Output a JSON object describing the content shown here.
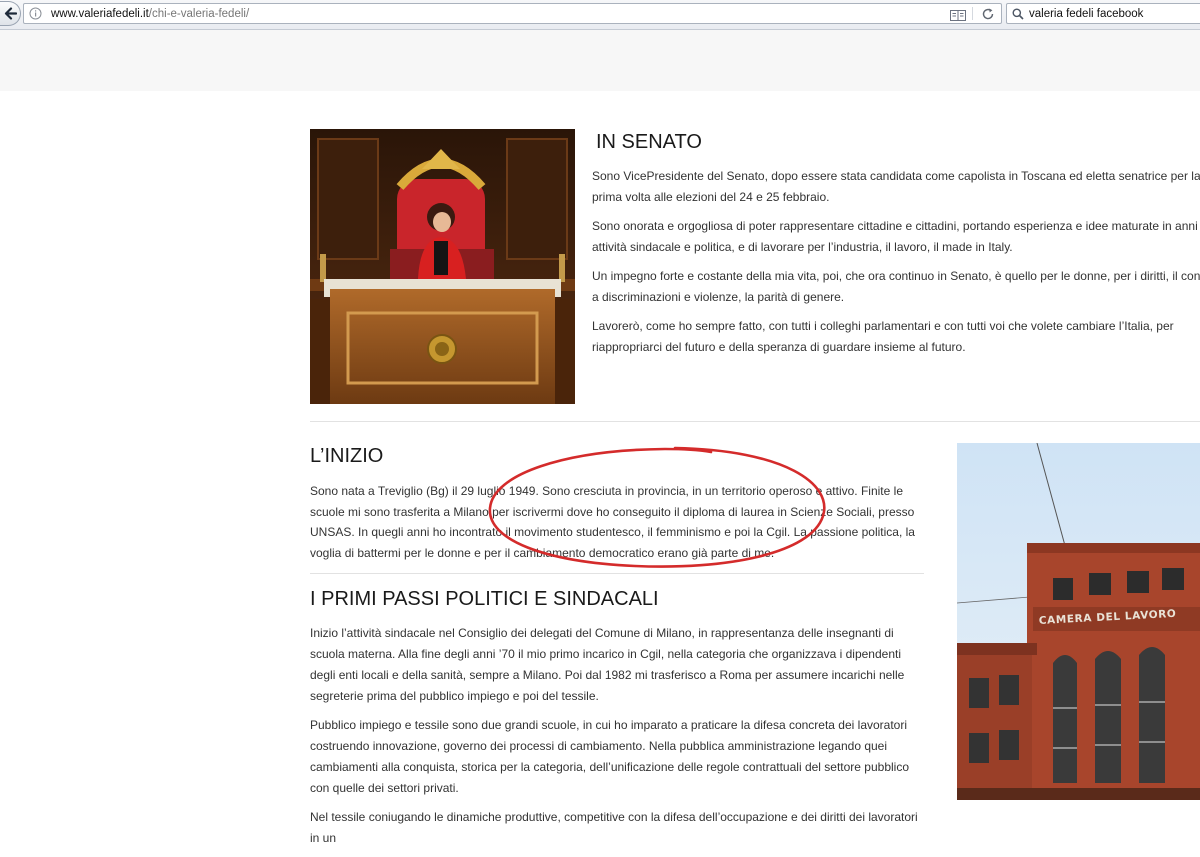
{
  "browser": {
    "url_domain": "www.valeriafedeli.it",
    "url_path": "/chi-e-valeria-fedeli/",
    "search_value": "valeria fedeli facebook"
  },
  "sections": {
    "senato": {
      "title": "IN SENATO",
      "paragraphs": [
        "Sono VicePresidente del Senato, dopo essere stata candidata come capolista in Toscana ed eletta senatrice per la prima volta alle elezioni del 24 e 25 febbraio.",
        "Sono onorata e orgogliosa di poter rappresentare cittadine e cittadini, portando esperienza e idee maturate in anni di attività sindacale e politica, e di lavorare per l’industria, il lavoro, il made in Italy.",
        "Un impegno forte e costante della mia vita, poi, che ora continuo in Senato, è quello per le donne, per i diritti, il contrasto a discriminazioni e violenze, la parità di genere.",
        "Lavorerò, come ho sempre fatto, con tutti i colleghi parlamentari e con tutti voi che volete cambiare l’Italia, per riappropriarci del futuro e della speranza di guardare insieme al futuro."
      ]
    },
    "inizio": {
      "title": "L’INIZIO",
      "paragraph": "Sono nata a Treviglio (Bg) il 29 luglio 1949. Sono cresciuta in provincia, in un territorio operoso e attivo. Finite le scuole mi sono trasferita a Milano per iscrivermi dove ho conseguito il diploma di laurea in Scienze Sociali, presso UNSAS. In quegli anni ho incontrato il movimento studentesco, il femminismo e poi la Cgil. La passione politica, la voglia di battermi per le donne e per il cambiamento democratico erano già parte di me."
    },
    "primi_passi": {
      "title": "I PRIMI PASSI POLITICI E SINDACALI",
      "paragraphs": [
        "Inizio l’attività sindacale nel Consiglio dei delegati del Comune di Milano, in rappresentanza delle insegnanti di scuola materna. Alla fine degli anni ’70 il mio primo incarico in Cgil, nella categoria che organizzava i dipendenti degli enti locali e della sanità, sempre a Milano. Poi dal 1982 mi trasferisco a Roma per assumere  incarichi nelle segreterie prima del pubblico impiego e poi del tessile.",
        "Pubblico impiego e tessile sono due grandi scuole, in cui ho imparato a praticare la difesa concreta dei lavoratori costruendo innovazione, governo dei processi di cambiamento. Nella pubblica amministrazione legando quei cambiamenti alla conquista, storica per la categoria, dell’unificazione delle regole contrattuali del settore pubblico con quelle dei settori privati.",
        "Nel tessile coniugando le dinamiche produttive, competitive con la difesa dell’occupazione e dei  diritti dei lavoratori in un"
      ]
    }
  },
  "images": {
    "building_sign": "CAMERA DEL LAVORO"
  },
  "colors": {
    "annotation_ellipse": "#d42b2b",
    "chrome_bg": "#eef1f5",
    "header_band": "#f7f7f7"
  }
}
